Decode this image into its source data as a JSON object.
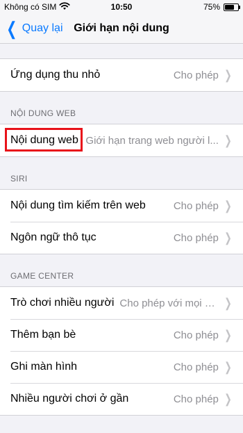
{
  "status_bar": {
    "carrier": "Không có SIM",
    "time": "10:50",
    "battery_percent": "75%",
    "battery_level": 0.75,
    "wifi_icon": "wifi-icon"
  },
  "nav": {
    "back_label": "Quay lại",
    "title": "Giới hạn nội dung"
  },
  "top_group": [
    {
      "label": "Ứng dụng thu nhỏ",
      "value": "Cho phép"
    }
  ],
  "web_section": {
    "header": "NỘI DUNG WEB",
    "rows": [
      {
        "label": "Nội dung web",
        "value": "Giới hạn trang web người l..."
      }
    ]
  },
  "siri_section": {
    "header": "SIRI",
    "rows": [
      {
        "label": "Nội dung tìm kiếm trên web",
        "value": "Cho phép"
      },
      {
        "label": "Ngôn ngữ thô tục",
        "value": "Cho phép"
      }
    ]
  },
  "game_section": {
    "header": "GAME CENTER",
    "rows": [
      {
        "label": "Trò chơi nhiều người",
        "value": "Cho phép với mọi n..."
      },
      {
        "label": "Thêm bạn bè",
        "value": "Cho phép"
      },
      {
        "label": "Ghi màn hình",
        "value": "Cho phép"
      },
      {
        "label": "Nhiều người chơi ở gần",
        "value": "Cho phép"
      }
    ]
  },
  "colors": {
    "accent": "#0a7aff",
    "highlight_border": "#e8121a",
    "background": "#f2f2f7"
  }
}
